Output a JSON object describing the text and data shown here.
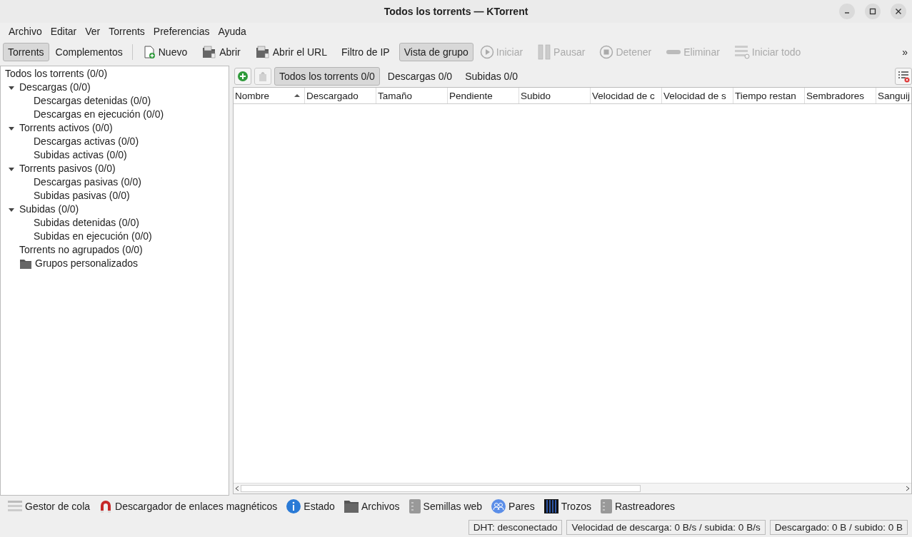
{
  "window": {
    "title": "Todos los torrents — KTorrent"
  },
  "menu": [
    "Archivo",
    "Editar",
    "Ver",
    "Torrents",
    "Preferencias",
    "Ayuda"
  ],
  "toolbar": [
    {
      "kind": "tab",
      "label": "Torrents",
      "selected": true
    },
    {
      "kind": "tab",
      "label": "Complementos",
      "selected": false
    },
    {
      "kind": "separator"
    },
    {
      "kind": "new",
      "label": "Nuevo",
      "disabled": false
    },
    {
      "kind": "open",
      "label": "Abrir",
      "disabled": false
    },
    {
      "kind": "open",
      "label": "Abrir el URL",
      "disabled": false
    },
    {
      "kind": "text",
      "label": "Filtro de IP",
      "disabled": false
    },
    {
      "kind": "toggle",
      "label": "Vista de grupo",
      "checked": true
    },
    {
      "kind": "play",
      "label": "Iniciar",
      "disabled": true
    },
    {
      "kind": "pause",
      "label": "Pausar",
      "disabled": true
    },
    {
      "kind": "stop",
      "label": "Detener",
      "disabled": true
    },
    {
      "kind": "remove",
      "label": "Eliminar",
      "disabled": true
    },
    {
      "kind": "startall",
      "label": "Iniciar todo",
      "disabled": true
    }
  ],
  "toolbar_overflow": "»",
  "groups": {
    "label": "Todos los torrents (0/0)",
    "children": [
      {
        "kind": "group",
        "label": "Descargas (0/0)",
        "expanded": true,
        "children": [
          {
            "label": "Descargas detenidas (0/0)"
          },
          {
            "label": "Descargas en ejecución (0/0)"
          }
        ]
      },
      {
        "kind": "group",
        "label": "Torrents activos (0/0)",
        "expanded": true,
        "children": [
          {
            "label": "Descargas activas (0/0)"
          },
          {
            "label": "Subidas activas (0/0)"
          }
        ]
      },
      {
        "kind": "group",
        "label": "Torrents pasivos (0/0)",
        "expanded": true,
        "children": [
          {
            "label": "Descargas pasivas (0/0)"
          },
          {
            "label": "Subidas pasivas (0/0)"
          }
        ]
      },
      {
        "kind": "group",
        "label": "Subidas (0/0)",
        "expanded": true,
        "children": [
          {
            "label": "Subidas detenidas (0/0)"
          },
          {
            "label": "Subidas en ejecución (0/0)"
          }
        ]
      },
      {
        "kind": "group",
        "label": "Torrents no agrupados (0/0)"
      },
      {
        "kind": "folder",
        "label": "Grupos personalizados"
      }
    ]
  },
  "view_tabs": [
    {
      "label": "Todos los torrents 0/0",
      "selected": true
    },
    {
      "label": "Descargas 0/0",
      "selected": false
    },
    {
      "label": "Subidas 0/0",
      "selected": false
    }
  ],
  "table": {
    "columns": [
      {
        "label": "Nombre",
        "sorted": true
      },
      {
        "label": "Descargado",
        "sorted": false
      },
      {
        "label": "Tamaño",
        "sorted": false
      },
      {
        "label": "Pendiente",
        "sorted": false
      },
      {
        "label": "Subido",
        "sorted": false
      },
      {
        "label": "Velocidad de c",
        "sorted": false
      },
      {
        "label": "Velocidad de s",
        "sorted": false
      },
      {
        "label": "Tiempo restan",
        "sorted": false
      },
      {
        "label": "Sembradores",
        "sorted": false
      },
      {
        "label": "Sanguij",
        "sorted": false
      }
    ]
  },
  "bottom_tabs": [
    {
      "kind": "queue",
      "label": "Gestor de cola"
    },
    {
      "kind": "magnet",
      "label": "Descargador de enlaces magnéticos"
    },
    {
      "kind": "info",
      "label": "Estado"
    },
    {
      "kind": "folder",
      "label": "Archivos"
    },
    {
      "kind": "server",
      "label": "Semillas web"
    },
    {
      "kind": "peers",
      "label": "Pares"
    },
    {
      "kind": "chunks",
      "label": "Trozos"
    },
    {
      "kind": "server",
      "label": "Rastreadores"
    }
  ],
  "status_bar": [
    "DHT: desconectado",
    "Velocidad de descarga: 0 B/s / subida: 0 B/s",
    "Descargado: 0 B / subido: 0 B"
  ]
}
